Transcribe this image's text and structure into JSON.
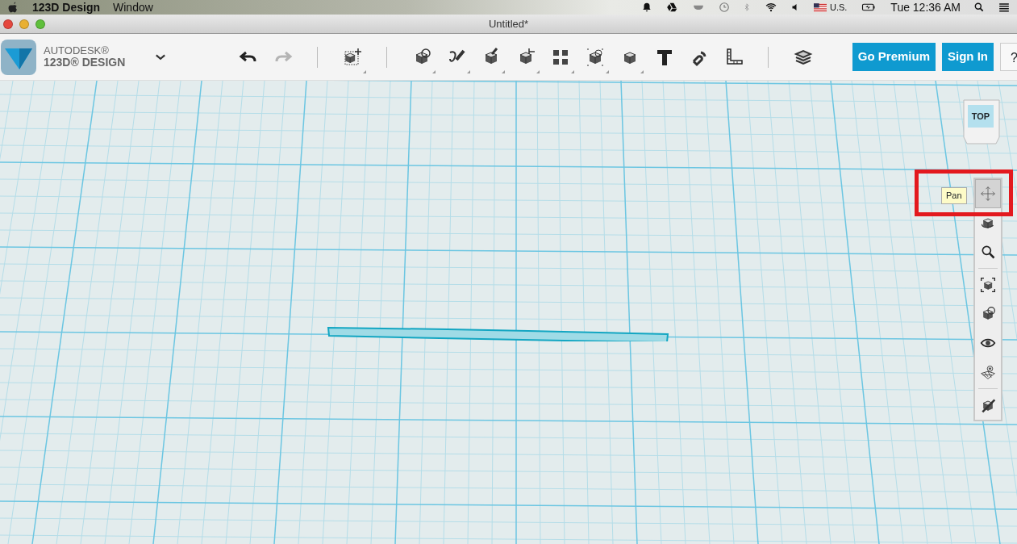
{
  "menu_bar": {
    "app_name": "123D Design",
    "menus": [
      "Window"
    ],
    "keyboard": "U.S.",
    "clock": "Tue 12:36 AM"
  },
  "window": {
    "title": "Untitled*"
  },
  "logo": {
    "brand": "AUTODESK®",
    "product": "123D® DESIGN"
  },
  "toolbar": [
    {
      "kind": "undo",
      "disabled": false,
      "has_menu": false
    },
    {
      "kind": "redo",
      "disabled": true,
      "has_menu": false
    },
    {
      "kind": "separator"
    },
    {
      "kind": "transform",
      "disabled": false,
      "has_menu": true
    },
    {
      "kind": "separator"
    },
    {
      "kind": "primitives",
      "disabled": false,
      "has_menu": true
    },
    {
      "kind": "sketch",
      "disabled": false,
      "has_menu": true
    },
    {
      "kind": "construct",
      "disabled": false,
      "has_menu": true
    },
    {
      "kind": "modify",
      "disabled": false,
      "has_menu": true
    },
    {
      "kind": "pattern",
      "disabled": false,
      "has_menu": true
    },
    {
      "kind": "grouping",
      "disabled": false,
      "has_menu": true
    },
    {
      "kind": "combine",
      "disabled": false,
      "has_menu": true
    },
    {
      "kind": "text",
      "disabled": false,
      "has_menu": false
    },
    {
      "kind": "snap",
      "disabled": false,
      "has_menu": false
    },
    {
      "kind": "measure",
      "disabled": false,
      "has_menu": false
    },
    {
      "kind": "separator"
    },
    {
      "kind": "materials",
      "disabled": false,
      "has_menu": false
    }
  ],
  "buttons": [
    {
      "label": "Go Premium",
      "kind": "primary"
    },
    {
      "label": "Sign In",
      "kind": "primary"
    },
    {
      "label": "?",
      "kind": "plain"
    }
  ],
  "view_cube": {
    "face": "TOP"
  },
  "nav_bar": [
    {
      "kind": "pan",
      "selected": true
    },
    {
      "kind": "orbit",
      "selected": false
    },
    {
      "kind": "zoom",
      "selected": false
    },
    {
      "kind": "separator"
    },
    {
      "kind": "fit",
      "selected": false
    },
    {
      "kind": "view",
      "selected": false
    },
    {
      "kind": "visibility",
      "selected": false
    },
    {
      "kind": "grid",
      "selected": false
    },
    {
      "kind": "separator"
    },
    {
      "kind": "material",
      "selected": false
    }
  ],
  "tooltip": {
    "text": "Pan"
  }
}
